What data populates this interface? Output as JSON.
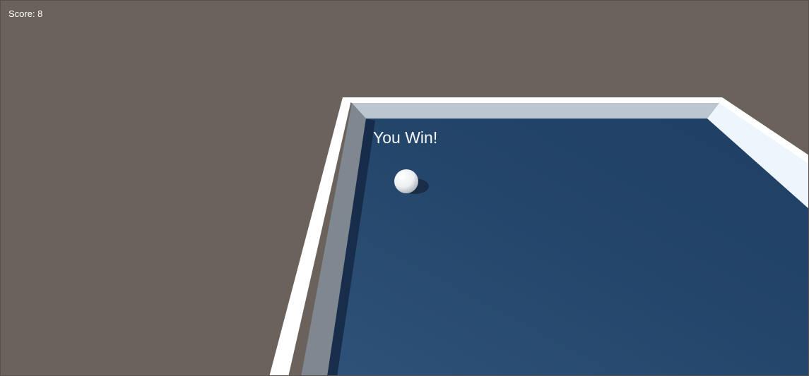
{
  "hud": {
    "score_text": "Score: 8"
  },
  "message": {
    "win_text": "You Win!"
  },
  "colors": {
    "background": "#6b625b",
    "floor": "#24456a",
    "wall_top": "#ffffff",
    "wall_inner_dark": "#7f8790",
    "wall_inner_light": "#bcc6d0",
    "wall_right": "#eef6fd",
    "ball": "#f2f4f6"
  }
}
